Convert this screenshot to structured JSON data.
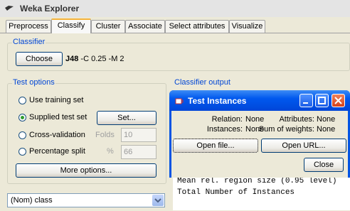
{
  "window": {
    "title": "Weka Explorer"
  },
  "tabs": [
    "Preprocess",
    "Classify",
    "Cluster",
    "Associate",
    "Select attributes",
    "Visualize"
  ],
  "classifier": {
    "group_label": "Classifier",
    "choose_label": "Choose",
    "name": "J48",
    "options": "-C 0.25 -M 2"
  },
  "test_options": {
    "group_label": "Test options",
    "use_training_set": "Use training set",
    "supplied_test_set": "Supplied test set",
    "set_button": "Set...",
    "cross_validation": "Cross-validation",
    "folds_label": "Folds",
    "folds_value": "10",
    "percentage_split": "Percentage split",
    "percent_symbol": "%",
    "percent_value": "66",
    "more_options": "More options...",
    "selected": "supplied_test_set"
  },
  "class_select": {
    "value": "(Nom) class"
  },
  "output": {
    "group_label": "Classifier output",
    "lines": [
      "Mean rel. region size (0.95 level)",
      "Total Number of Instances"
    ]
  },
  "dialog": {
    "title": "Test Instances",
    "relation_label": "Relation:",
    "relation_value": "None",
    "attributes_label": "Attributes:",
    "attributes_value": "None",
    "instances_label": "Instances:",
    "instances_value": "None",
    "weights_label": "Sum of weights:",
    "weights_value": "None",
    "open_file": "Open file...",
    "open_url": "Open URL...",
    "close": "Close"
  },
  "colors": {
    "accent": "#0046d5",
    "xp_title": "#0054e3",
    "close_button": "#e0502a"
  }
}
